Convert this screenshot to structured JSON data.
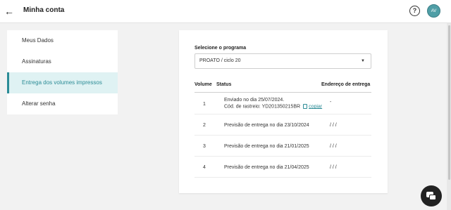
{
  "header": {
    "title": "Minha conta",
    "avatar_initials": "AV",
    "help_glyph": "?"
  },
  "sidebar": {
    "items": [
      {
        "label": "Meus Dados",
        "active": false
      },
      {
        "label": "Assinaturas",
        "active": false
      },
      {
        "label": "Entrega dos volumes impressos",
        "active": true
      },
      {
        "label": "Alterar senha",
        "active": false
      }
    ]
  },
  "program": {
    "label": "Selecione o programa",
    "selected": "PROATO / ciclo 20"
  },
  "table": {
    "headers": {
      "volume": "Volume",
      "status": "Status",
      "address": "Endereço de entrega"
    },
    "rows": [
      {
        "volume": "1",
        "status_line1": "Enviado no dia 25/07/2024.",
        "status_line2": "Cód. de rastreio: YD201350215BR",
        "copy_label": "copiar",
        "address": "-"
      },
      {
        "volume": "2",
        "status": "Previsão de entrega no dia 23/10/2024",
        "address": "/ / /"
      },
      {
        "volume": "3",
        "status": "Previsão de entrega no dia 21/01/2025",
        "address": "/ / /"
      },
      {
        "volume": "4",
        "status": "Previsão de entrega no dia 21/04/2025",
        "address": "/ / /"
      }
    ]
  },
  "colors": {
    "accent": "#2c8c96",
    "active_bg": "#dff2f3",
    "avatar": "#4f9ea6"
  },
  "icons": [
    "arrow-left-icon",
    "help-icon",
    "chevron-down-icon",
    "copy-icon",
    "chat-icon"
  ]
}
